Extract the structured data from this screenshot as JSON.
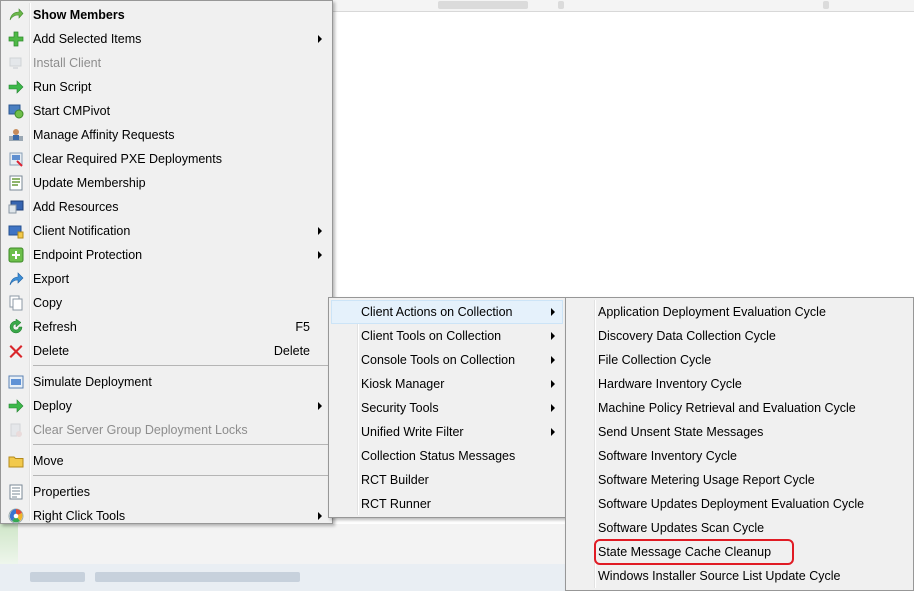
{
  "main_menu": {
    "items": [
      {
        "label": "Show Members",
        "icon": "show-members-icon",
        "bold": true
      },
      {
        "label": "Add Selected Items",
        "icon": "add-icon",
        "submenu": true
      },
      {
        "label": "Install Client",
        "icon": "install-client-icon",
        "disabled": true
      },
      {
        "label": "Run Script",
        "icon": "run-script-icon"
      },
      {
        "label": "Start CMPivot",
        "icon": "cmpivot-icon"
      },
      {
        "label": "Manage Affinity Requests",
        "icon": "affinity-icon"
      },
      {
        "label": "Clear Required PXE Deployments",
        "icon": "pxe-icon"
      },
      {
        "label": "Update Membership",
        "icon": "update-membership-icon"
      },
      {
        "label": "Add Resources",
        "icon": "add-resources-icon"
      },
      {
        "label": "Client Notification",
        "icon": "client-notification-icon",
        "submenu": true
      },
      {
        "label": "Endpoint Protection",
        "icon": "endpoint-protection-icon",
        "submenu": true
      },
      {
        "label": "Export",
        "icon": "export-icon"
      },
      {
        "label": "Copy",
        "icon": "copy-icon"
      },
      {
        "label": "Refresh",
        "icon": "refresh-icon",
        "shortcut": "F5"
      },
      {
        "label": "Delete",
        "icon": "delete-icon",
        "shortcut": "Delete"
      },
      {
        "separator": true
      },
      {
        "label": "Simulate Deployment",
        "icon": "simulate-deployment-icon"
      },
      {
        "label": "Deploy",
        "icon": "deploy-icon",
        "submenu": true
      },
      {
        "label": "Clear Server Group Deployment Locks",
        "icon": "server-group-icon",
        "disabled": true
      },
      {
        "separator": true
      },
      {
        "label": "Move",
        "icon": "move-folder-icon"
      },
      {
        "separator": true
      },
      {
        "label": "Properties",
        "icon": "properties-icon"
      },
      {
        "label": "Right Click Tools",
        "icon": "right-click-tools-icon",
        "submenu": true
      }
    ]
  },
  "rct_menu": {
    "items": [
      {
        "label": "Client Actions on Collection",
        "submenu": true,
        "highlighted": true
      },
      {
        "label": "Client Tools on Collection",
        "submenu": true
      },
      {
        "label": "Console Tools on Collection",
        "submenu": true
      },
      {
        "label": "Kiosk Manager",
        "submenu": true
      },
      {
        "label": "Security Tools",
        "submenu": true
      },
      {
        "label": "Unified Write Filter",
        "submenu": true
      },
      {
        "label": "Collection Status Messages"
      },
      {
        "label": "RCT Builder"
      },
      {
        "label": "RCT Runner"
      }
    ]
  },
  "actions_menu": {
    "items": [
      {
        "label": "Application Deployment Evaluation Cycle"
      },
      {
        "label": "Discovery Data Collection Cycle"
      },
      {
        "label": "File Collection Cycle"
      },
      {
        "label": "Hardware Inventory Cycle"
      },
      {
        "label": "Machine Policy Retrieval and Evaluation Cycle"
      },
      {
        "label": "Send Unsent State Messages"
      },
      {
        "label": "Software Inventory Cycle"
      },
      {
        "label": "Software Metering Usage Report Cycle"
      },
      {
        "label": "Software Updates Deployment Evaluation Cycle"
      },
      {
        "label": "Software Updates Scan Cycle"
      },
      {
        "label": "State Message Cache Cleanup",
        "annotated": true
      },
      {
        "label": "Windows Installer Source List Update Cycle"
      }
    ]
  },
  "colors": {
    "menu_bg": "#f0f0f0",
    "highlight": "#e5f1fb",
    "annotation": "#e01b24",
    "disabled_text": "#8d8d8d"
  }
}
